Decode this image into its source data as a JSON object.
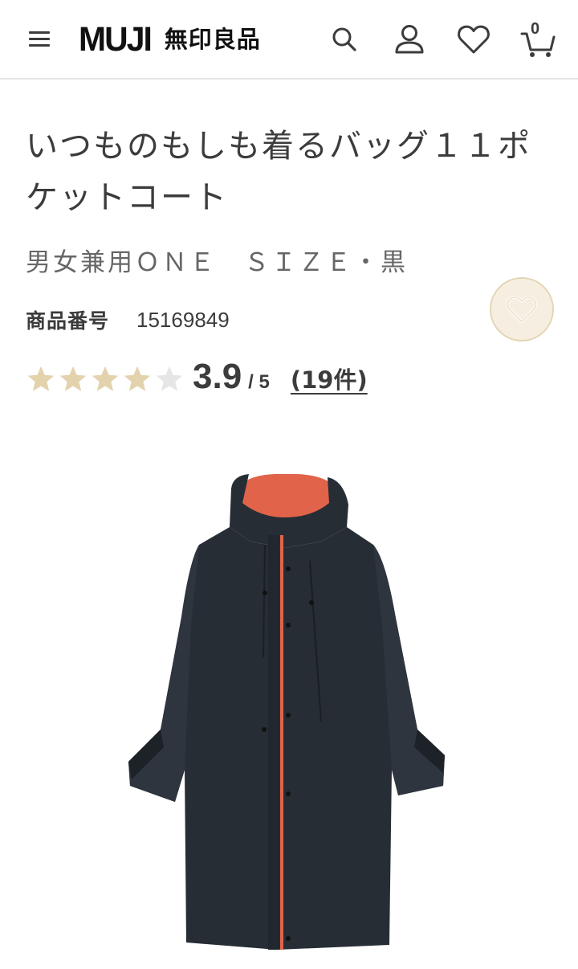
{
  "header": {
    "logo_text": "MUJI",
    "logo_jp": "無印良品",
    "cart_count": "0",
    "icons": [
      "menu-icon",
      "search-icon",
      "account-icon",
      "heart-icon",
      "cart-icon"
    ]
  },
  "product": {
    "title": "いつものもしも着るバッグ１１ポケットコート",
    "variant": "男女兼用ＯＮＥ　ＳＩＺＥ・黒",
    "code_label": "商品番号",
    "code_value": "15169849",
    "rating": {
      "value": "3.9",
      "max": "/ 5",
      "stars_filled": 4,
      "stars_total": 5,
      "review_count_label": "(19件)"
    }
  },
  "colors": {
    "text": "#3c3c3c",
    "star_filled": "#e3d3ad",
    "star_empty": "#e6e6e6",
    "fav_bg": "#f6efe1",
    "fav_border": "#e3d6b5",
    "coat": "#262d35",
    "coat_lining": "#e0634a"
  }
}
